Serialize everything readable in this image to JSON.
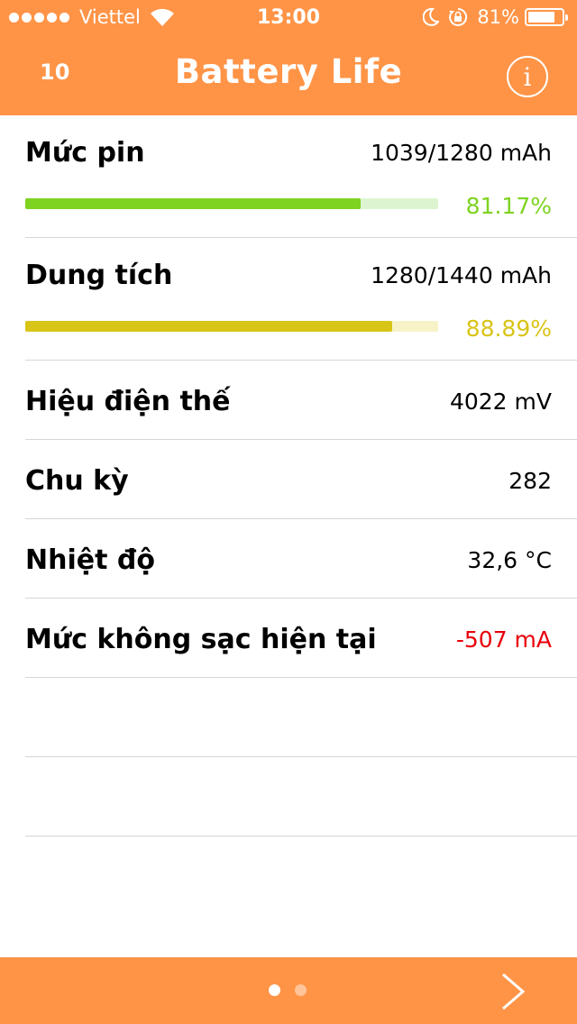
{
  "status_bar": {
    "carrier": "Viettel",
    "time": "13:00",
    "battery_percent_label": "81%",
    "battery_level": 0.81,
    "icons": [
      "signal-dots-icon",
      "wifi-icon",
      "moon-icon",
      "orientation-lock-icon",
      "battery-icon"
    ]
  },
  "nav": {
    "left_label": "10",
    "title": "Battery Life",
    "info_glyph": "i"
  },
  "rows": [
    {
      "label": "Mức pin",
      "value": "1039/1280 mAh",
      "percent_label": "81.17%",
      "fraction": 0.8117,
      "bar_color": "#7ed321",
      "track_color": "#dcf5d0"
    },
    {
      "label": "Dung tích",
      "value": "1280/1440 mAh",
      "percent_label": "88.89%",
      "fraction": 0.8889,
      "bar_color": "#d9c418",
      "track_color": "#f7f3c8"
    },
    {
      "label": "Hiệu điện thế",
      "value": "4022 mV"
    },
    {
      "label": "Chu kỳ",
      "value": "282"
    },
    {
      "label": "Nhiệt độ",
      "value": "32,6 °C"
    },
    {
      "label": "Mức không sạc hiện tại",
      "value": "-507 mA",
      "value_color": "#e8000b"
    }
  ],
  "footer": {
    "page_count": 2,
    "current_page": 1,
    "next_icon": "chevron-right-icon"
  },
  "colors": {
    "accent": "#ff9447",
    "separator": "#d6d6d6"
  }
}
